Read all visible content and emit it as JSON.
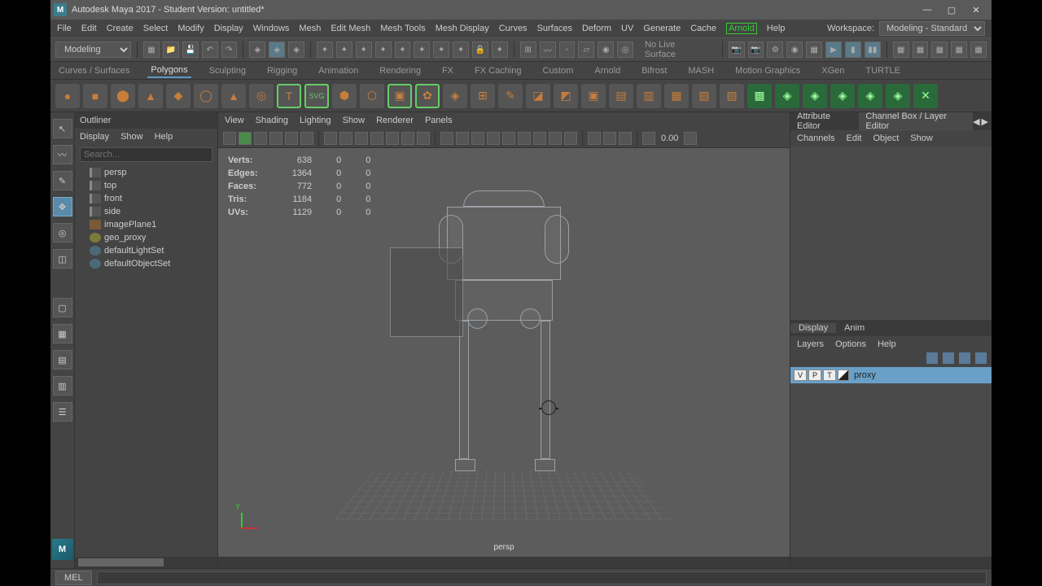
{
  "title": "Autodesk Maya 2017 - Student Version: untitled*",
  "menus": [
    "File",
    "Edit",
    "Create",
    "Select",
    "Modify",
    "Display",
    "Windows",
    "Mesh",
    "Edit Mesh",
    "Mesh Tools",
    "Mesh Display",
    "Curves",
    "Surfaces",
    "Deform",
    "UV",
    "Generate",
    "Cache"
  ],
  "arnold": "Arnold",
  "help": "Help",
  "workspace_label": "Workspace:",
  "workspace": "Modeling - Standard",
  "mode": "Modeling",
  "nolive": "No Live Surface",
  "shelftabs": [
    "Curves / Surfaces",
    "Polygons",
    "Sculpting",
    "Rigging",
    "Animation",
    "Rendering",
    "FX",
    "FX Caching",
    "Custom",
    "Arnold",
    "Bifrost",
    "MASH",
    "Motion Graphics",
    "XGen",
    "TURTLE"
  ],
  "outliner": {
    "title": "Outliner",
    "menu": [
      "Display",
      "Show",
      "Help"
    ],
    "search": "Search...",
    "nodes": [
      {
        "icon": "cam",
        "label": "persp"
      },
      {
        "icon": "cam",
        "label": "top"
      },
      {
        "icon": "cam",
        "label": "front"
      },
      {
        "icon": "cam",
        "label": "side"
      },
      {
        "icon": "plane",
        "label": "imagePlane1"
      },
      {
        "icon": "geo",
        "label": "geo_proxy"
      },
      {
        "icon": "set",
        "label": "defaultLightSet"
      },
      {
        "icon": "set",
        "label": "defaultObjectSet"
      }
    ]
  },
  "viewport": {
    "menu": [
      "View",
      "Shading",
      "Lighting",
      "Show",
      "Renderer",
      "Panels"
    ],
    "rot": "0.00",
    "hud": [
      [
        "Verts:",
        "638",
        "0",
        "0"
      ],
      [
        "Edges:",
        "1364",
        "0",
        "0"
      ],
      [
        "Faces:",
        "772",
        "0",
        "0"
      ],
      [
        "Tris:",
        "1184",
        "0",
        "0"
      ],
      [
        "UVs:",
        "1129",
        "0",
        "0"
      ]
    ],
    "camera": "persp",
    "axis_y": "y"
  },
  "right": {
    "tabs": [
      "Attribute Editor",
      "Channel Box / Layer Editor"
    ],
    "menu": [
      "Channels",
      "Edit",
      "Object",
      "Show"
    ],
    "ltabs": [
      "Display",
      "Anim"
    ],
    "lmenu": [
      "Layers",
      "Options",
      "Help"
    ],
    "layer": {
      "v": "V",
      "p": "P",
      "t": "T",
      "name": "proxy"
    }
  },
  "cmd": "MEL"
}
